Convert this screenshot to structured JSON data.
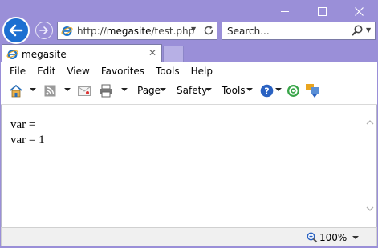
{
  "address": {
    "url_prefix": "http://",
    "url_host": "megasite",
    "url_path": "/test.php"
  },
  "search": {
    "placeholder": "Search..."
  },
  "tab": {
    "title": "megasite"
  },
  "menu": [
    "File",
    "Edit",
    "View",
    "Favorites",
    "Tools",
    "Help"
  ],
  "command_bar": {
    "page": "Page",
    "safety": "Safety",
    "tools": "Tools"
  },
  "content": {
    "line1": "var =",
    "line2": "var = 1"
  },
  "status": {
    "zoom": "100%"
  },
  "colors": {
    "frame": "#9a8fd8",
    "back_button": "#1c6fd1",
    "ie_blue": "#1a73c9"
  },
  "icons": [
    "back-arrow-icon",
    "forward-arrow-icon",
    "ie-logo-icon",
    "refresh-icon",
    "search-magnifier-icon",
    "home-icon",
    "rss-feed-icon",
    "mail-icon",
    "print-icon",
    "help-icon",
    "research-icon",
    "translate-icon",
    "zoom-icon",
    "scroll-up-icon",
    "scroll-down-icon"
  ]
}
